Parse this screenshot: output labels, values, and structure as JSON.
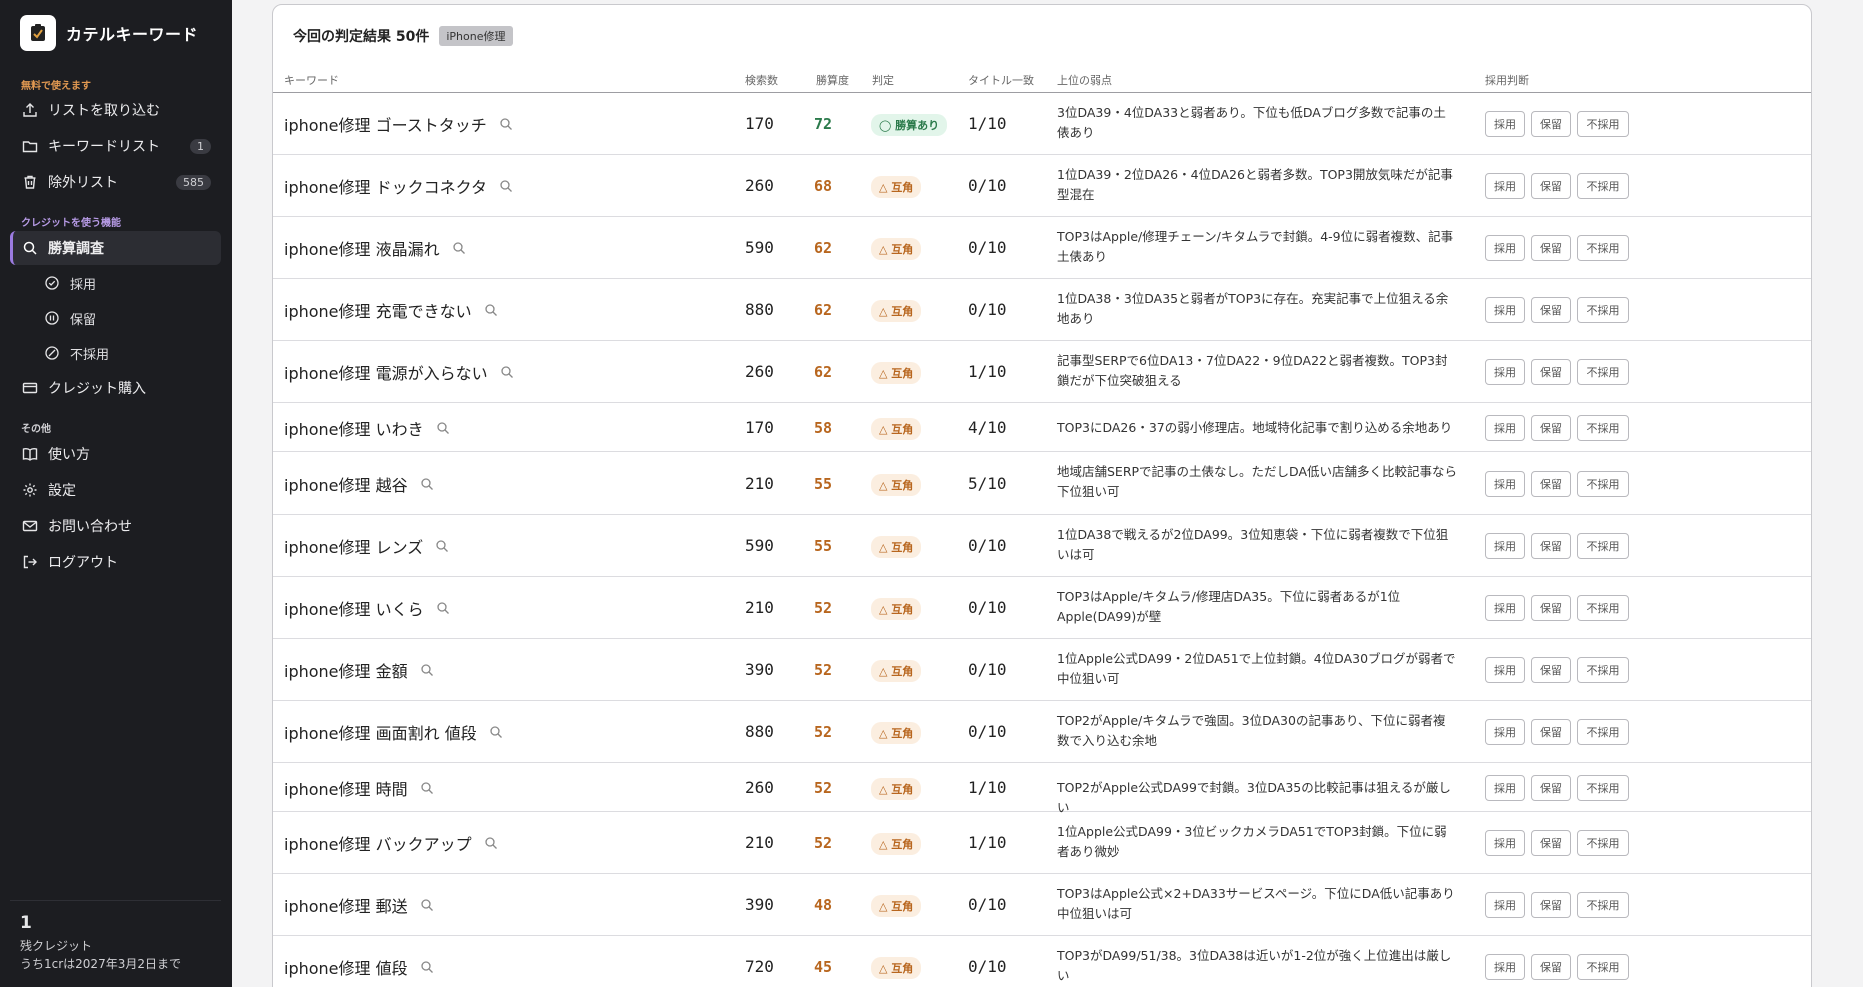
{
  "app": {
    "name": "カテルキーワード"
  },
  "sidebar": {
    "sections": {
      "free": "無料で使えます",
      "credit": "クレジットを使う機能",
      "other": "その他"
    },
    "items": [
      {
        "label": "リストを取り込む",
        "icon": "upload-icon"
      },
      {
        "label": "キーワードリスト",
        "icon": "folder-icon",
        "badge": "1"
      },
      {
        "label": "除外リスト",
        "icon": "trash-icon",
        "badge": "585"
      },
      {
        "label": "勝算調査",
        "icon": "search-icon"
      },
      {
        "label": "採用",
        "icon": "check-circle-icon"
      },
      {
        "label": "保留",
        "icon": "pause-circle-icon"
      },
      {
        "label": "不採用",
        "icon": "ban-circle-icon"
      },
      {
        "label": "クレジット購入",
        "icon": "card-icon"
      },
      {
        "label": "使い方",
        "icon": "book-icon"
      },
      {
        "label": "設定",
        "icon": "gear-icon"
      },
      {
        "label": "お問い合わせ",
        "icon": "mail-icon"
      },
      {
        "label": "ログアウト",
        "icon": "logout-icon"
      }
    ],
    "credit": {
      "count": "1",
      "label": "残クレジット",
      "expiry": "うち1crは2027年3月2日まで"
    }
  },
  "main": {
    "title": "今回の判定結果 50件",
    "tag": "iPhone修理",
    "columns": {
      "keyword": "キーワード",
      "volume": "検索数",
      "score": "勝算度",
      "judge": "判定",
      "title_match": "タイトル一致",
      "weakness": "上位の弱点",
      "decision": "採用判断"
    },
    "actions": {
      "adopt": "採用",
      "hold": "保留",
      "reject": "不採用"
    },
    "colors": {
      "win": "#2b7a4b",
      "even": "#b8661e",
      "accent": "#9b7be0"
    },
    "rows": [
      {
        "keyword": "iphone修理 ゴーストタッチ",
        "volume": "170",
        "score": "72",
        "judge": "◯ 勝算あり",
        "status": "win",
        "title_match": "1/10",
        "weakness": "3位DA39・4位DA33と弱者あり。下位も低DAブログ多数で記事の土俵あり"
      },
      {
        "keyword": "iphone修理 ドックコネクタ",
        "volume": "260",
        "score": "68",
        "judge": "△ 互角",
        "status": "even",
        "title_match": "0/10",
        "weakness": "1位DA39・2位DA26・4位DA26と弱者多数。TOP3開放気味だが記事型混在"
      },
      {
        "keyword": "iphone修理 液晶漏れ",
        "volume": "590",
        "score": "62",
        "judge": "△ 互角",
        "status": "even",
        "title_match": "0/10",
        "weakness": "TOP3はApple/修理チェーン/キタムラで封鎖。4-9位に弱者複数、記事土俵あり"
      },
      {
        "keyword": "iphone修理 充電できない",
        "volume": "880",
        "score": "62",
        "judge": "△ 互角",
        "status": "even",
        "title_match": "0/10",
        "weakness": "1位DA38・3位DA35と弱者がTOP3に存在。充実記事で上位狙える余地あり"
      },
      {
        "keyword": "iphone修理 電源が入らない",
        "volume": "260",
        "score": "62",
        "judge": "△ 互角",
        "status": "even",
        "title_match": "1/10",
        "weakness": "記事型SERPで6位DA13・7位DA22・9位DA22と弱者複数。TOP3封鎖だが下位突破狙える"
      },
      {
        "keyword": "iphone修理 いわき",
        "volume": "170",
        "score": "58",
        "judge": "△ 互角",
        "status": "even",
        "title_match": "4/10",
        "weakness": "TOP3にDA26・37の弱小修理店。地域特化記事で割り込める余地あり"
      },
      {
        "keyword": "iphone修理 越谷",
        "volume": "210",
        "score": "55",
        "judge": "△ 互角",
        "status": "even",
        "title_match": "5/10",
        "weakness": "地域店舗SERPで記事の土俵なし。ただしDA低い店舗多く比較記事なら下位狙い可"
      },
      {
        "keyword": "iphone修理 レンズ",
        "volume": "590",
        "score": "55",
        "judge": "△ 互角",
        "status": "even",
        "title_match": "0/10",
        "weakness": "1位DA38で戦えるが2位DA99。3位知恵袋・下位に弱者複数で下位狙いは可"
      },
      {
        "keyword": "iphone修理 いくら",
        "volume": "210",
        "score": "52",
        "judge": "△ 互角",
        "status": "even",
        "title_match": "0/10",
        "weakness": "TOP3はApple/キタムラ/修理店DA35。下位に弱者あるが1位Apple(DA99)が壁"
      },
      {
        "keyword": "iphone修理 金額",
        "volume": "390",
        "score": "52",
        "judge": "△ 互角",
        "status": "even",
        "title_match": "0/10",
        "weakness": "1位Apple公式DA99・2位DA51で上位封鎖。4位DA30ブログが弱者で中位狙い可"
      },
      {
        "keyword": "iphone修理 画面割れ 値段",
        "volume": "880",
        "score": "52",
        "judge": "△ 互角",
        "status": "even",
        "title_match": "0/10",
        "weakness": "TOP2がApple/キタムラで強固。3位DA30の記事あり、下位に弱者複数で入り込む余地"
      },
      {
        "keyword": "iphone修理 時間",
        "volume": "260",
        "score": "52",
        "judge": "△ 互角",
        "status": "even",
        "title_match": "1/10",
        "weakness": "TOP2がApple公式DA99で封鎖。3位DA35の比較記事は狙えるが厳しい"
      },
      {
        "keyword": "iphone修理 バックアップ",
        "volume": "210",
        "score": "52",
        "judge": "△ 互角",
        "status": "even",
        "title_match": "1/10",
        "weakness": "1位Apple公式DA99・3位ビックカメラDA51でTOP3封鎖。下位に弱者あり微妙"
      },
      {
        "keyword": "iphone修理 郵送",
        "volume": "390",
        "score": "48",
        "judge": "△ 互角",
        "status": "even",
        "title_match": "0/10",
        "weakness": "TOP3はApple公式×2+DA33サービスページ。下位にDA低い記事あり中位狙いは可"
      },
      {
        "keyword": "iphone修理 値段",
        "volume": "720",
        "score": "45",
        "judge": "△ 互角",
        "status": "even",
        "title_match": "0/10",
        "weakness": "TOP3がDA99/51/38。3位DA38は近いが1-2位が強く上位進出は厳しい"
      }
    ]
  }
}
